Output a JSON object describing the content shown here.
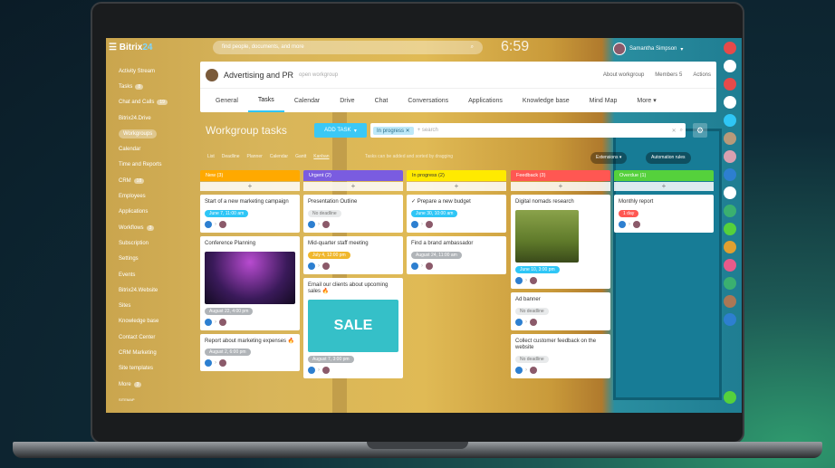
{
  "app": {
    "logo_main": "Bitrix",
    "logo_accent": "24",
    "search_placeholder": "find people, documents, and more",
    "clock": "6:59",
    "user_name": "Samantha Simpson"
  },
  "sidebar": {
    "items": [
      {
        "label": "Activity Stream",
        "count": ""
      },
      {
        "label": "Tasks",
        "count": "8"
      },
      {
        "label": "Chat and Calls",
        "count": "19"
      },
      {
        "label": "Bitrix24.Drive",
        "count": ""
      },
      {
        "label": "Workgroups",
        "count": ""
      },
      {
        "label": "Calendar",
        "count": ""
      },
      {
        "label": "Time and Reports",
        "count": ""
      },
      {
        "label": "CRM",
        "count": "18"
      },
      {
        "label": "Employees",
        "count": ""
      },
      {
        "label": "Applications",
        "count": ""
      },
      {
        "label": "Workflows",
        "count": "3"
      },
      {
        "label": "Subscription",
        "count": ""
      },
      {
        "label": "Settings",
        "count": ""
      },
      {
        "label": "Events",
        "count": ""
      },
      {
        "label": "Bitrix24.Website",
        "count": ""
      },
      {
        "label": "Sites",
        "count": ""
      },
      {
        "label": "Knowledge base",
        "count": ""
      },
      {
        "label": "Contact Center",
        "count": ""
      },
      {
        "label": "CRM Marketing",
        "count": ""
      },
      {
        "label": "Site templates",
        "count": ""
      },
      {
        "label": "More",
        "count": "3"
      }
    ],
    "footer": "SITEMAP"
  },
  "group": {
    "name": "Advertising and PR",
    "subtitle": "open workgroup",
    "links": [
      "About workgroup",
      "Members 5",
      "Actions"
    ]
  },
  "tabs": [
    "General",
    "Tasks",
    "Calendar",
    "Drive",
    "Chat",
    "Conversations",
    "Applications",
    "Knowledge base",
    "Mind Map",
    "More ▾"
  ],
  "toolbar": {
    "title": "Workgroup tasks",
    "add_label": "ADD TASK",
    "filter_chip": "In progress",
    "search_placeholder": "+ search",
    "views": [
      "List",
      "Deadline",
      "Planner",
      "Calendar",
      "Gantt",
      "Kanban"
    ],
    "hint": "Tasks can be added and sorted by dragging",
    "extensions_label": "Extensions",
    "automation_label": "Automation rules"
  },
  "columns": [
    {
      "title": "New",
      "count": "3",
      "color": "#ffa900",
      "cards": [
        {
          "title": "Start of a new marketing campaign",
          "badge": "June 7, 11:00 am",
          "badge_color": "#2fc6f6"
        },
        {
          "title": "Conference Planning",
          "badge": "August 22, 4:00 pm",
          "badge_color": "#b0b4b8",
          "image": "conference"
        },
        {
          "title": "Report about marketing expenses 🔥",
          "badge": "August 2, 6:00 pm",
          "badge_color": "#b0b4b8"
        }
      ]
    },
    {
      "title": "Urgent",
      "count": "2",
      "color": "#7a5ce0",
      "cards": [
        {
          "title": "Presentation Outline",
          "badge": "No deadline",
          "badge_color": "#e8eaeb"
        },
        {
          "title": "Mid-quarter staff meeting",
          "badge": "July 4, 12:00 pm",
          "badge_color": "#f0b72d"
        },
        {
          "title": "Email our clients about upcoming sales 🔥",
          "badge": "August 7, 3:00 pm",
          "badge_color": "#b0b4b8",
          "image": "sale"
        }
      ]
    },
    {
      "title": "In progress",
      "count": "2",
      "color": "#ffea00",
      "cards": [
        {
          "title": "✓ Prepare a new budget",
          "badge": "June 30, 10:00 am",
          "badge_color": "#2fc6f6"
        },
        {
          "title": "Find a brand ambassador",
          "badge": "August 24, 11:00 am",
          "badge_color": "#b0b4b8"
        }
      ]
    },
    {
      "title": "Feedback",
      "count": "3",
      "color": "#ff5752",
      "cards": [
        {
          "title": "Digital nomads research",
          "badge": "June 10, 3:00 pm",
          "badge_color": "#2fc6f6",
          "image": "nomad"
        },
        {
          "title": "Ad banner",
          "badge": "No deadline",
          "badge_color": "#e8eaeb"
        },
        {
          "title": "Collect customer feedback on the website",
          "badge": "No deadline",
          "badge_color": "#e8eaeb"
        }
      ]
    },
    {
      "title": "Overdue",
      "count": "1",
      "color": "#55d13c",
      "cards": [
        {
          "title": "Monthly report",
          "badge": "1 day",
          "badge_color": "#ff5752"
        }
      ]
    }
  ],
  "colors": {
    "accent": "#2fc6f6",
    "add_button": "#3bc8f5"
  },
  "images": {
    "sale_text": "SALE"
  }
}
